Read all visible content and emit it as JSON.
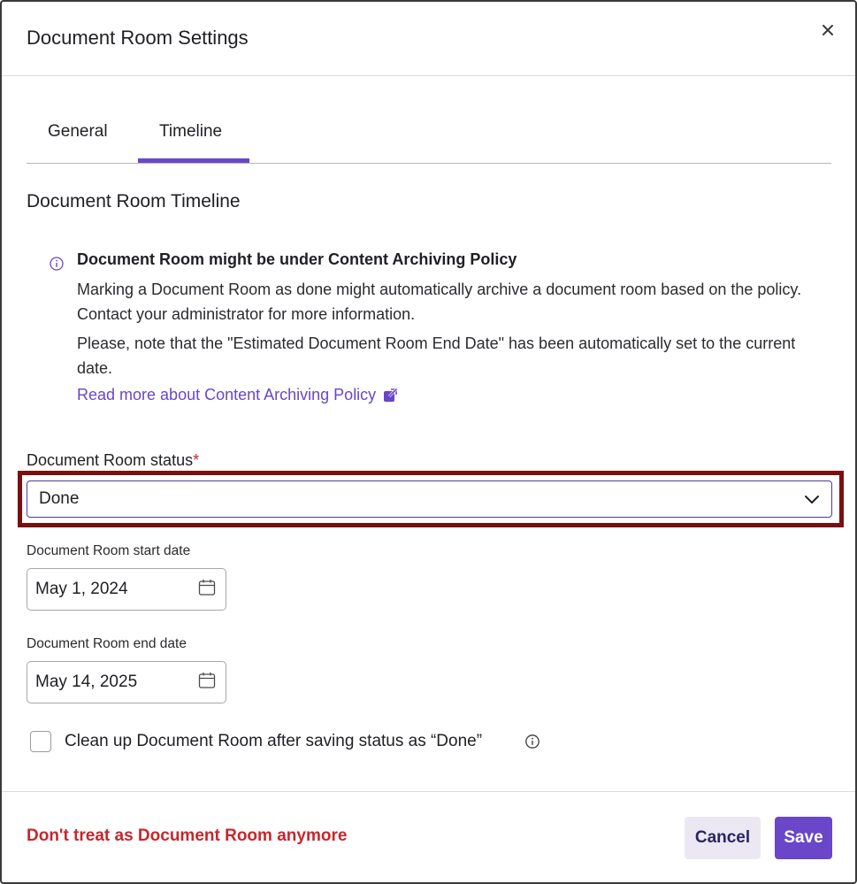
{
  "dialog": {
    "title": "Document Room Settings"
  },
  "tabs": [
    {
      "label": "General",
      "active": false
    },
    {
      "label": "Timeline",
      "active": true
    }
  ],
  "section": {
    "title": "Document Room Timeline"
  },
  "notice": {
    "heading": "Document Room might be under Content Archiving Policy",
    "text1": "Marking a Document Room as done might automatically archive a document room based on the policy. Contact your administrator for more information.",
    "text2": "Please, note that the \"Estimated Document Room End Date\" has been automatically set to the current date.",
    "link": "Read more about Content Archiving Policy"
  },
  "status_field": {
    "label": "Document Room status",
    "required_marker": "*",
    "value": "Done"
  },
  "start_date": {
    "label": "Document Room start date",
    "value": "May 1, 2024"
  },
  "end_date": {
    "label": "Document Room end date",
    "value": "May 14, 2025"
  },
  "cleanup": {
    "label": "Clean up Document Room after saving status as “Done”",
    "checked": false
  },
  "footer": {
    "danger_link": "Don't treat as Document Room anymore",
    "cancel_label": "Cancel",
    "save_label": "Save"
  },
  "colors": {
    "accent": "#6a46c8",
    "danger": "#c8262d",
    "highlight": "#7a0f0f"
  }
}
